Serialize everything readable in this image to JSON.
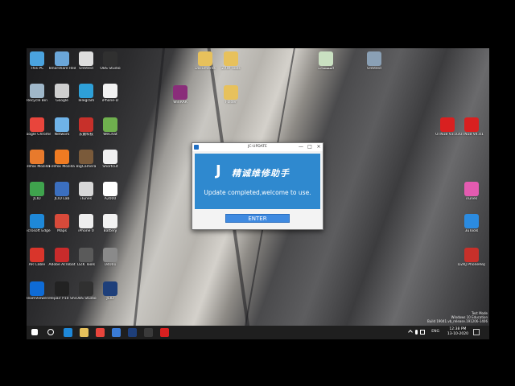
{
  "dialog": {
    "title": "JC-UPDATE",
    "brand_text": "精诚维修助手",
    "logo_glyph": "J",
    "message": "Update completed,welcome to use.",
    "enter_label": "ENTER",
    "minimize_glyph": "—",
    "maximize_glyph": "□",
    "close_glyph": "×"
  },
  "desktop": {
    "icons_left": [
      {
        "label": "This PC",
        "color": "#4aa3df"
      },
      {
        "label": "Recycle Bin",
        "color": "#9fb7c9"
      },
      {
        "label": "Google Chrome",
        "color": "#e8453c"
      },
      {
        "label": "Firefox Mozilla",
        "color": "#e87a2c"
      },
      {
        "label": "JCID",
        "color": "#3fa34d"
      },
      {
        "label": "Microsoft Edge",
        "color": "#1e88d8"
      },
      {
        "label": "AR Cable",
        "color": "#d9352b"
      },
      {
        "label": "TeamViewer",
        "color": "#0e6bd6"
      }
    ],
    "icons_col2": [
      {
        "label": "Tenorshare ReiBoot",
        "color": "#6aa6d9"
      },
      {
        "label": "Google",
        "color": "#cfcfcf"
      },
      {
        "label": "Network",
        "color": "#6fb3e8"
      },
      {
        "label": "Firefox Mozilla",
        "color": "#f07b22"
      },
      {
        "label": "JCID Lab",
        "color": "#3b6fbf"
      },
      {
        "label": "Maps",
        "color": "#d84a3a"
      },
      {
        "label": "Adobe Acrobat",
        "color": "#c92b2b"
      },
      {
        "label": "iRepair P10 Shortcut",
        "color": "#222222"
      }
    ],
    "icons_col3": [
      {
        "label": "Untitled",
        "color": "#dedede"
      },
      {
        "label": "Telegram",
        "color": "#2ea0d8"
      },
      {
        "label": "东震科技",
        "color": "#c7302a"
      },
      {
        "label": "BigCamera",
        "color": "#7a5a3a"
      },
      {
        "label": "iTunes",
        "color": "#d8d8d8"
      },
      {
        "label": "iPhone 0",
        "color": "#eeeeee"
      },
      {
        "label": "DZK Tools",
        "color": "#5a5a5a"
      },
      {
        "label": "OBS Studio",
        "color": "#303030"
      }
    ],
    "icons_col4": [
      {
        "label": "OBS Studio",
        "color": "#303030"
      },
      {
        "label": "iPhone-D",
        "color": "#f2f2f2"
      },
      {
        "label": "WeChat",
        "color": "#6fb04e"
      },
      {
        "label": "Shortcut",
        "color": "#f0f0f0"
      },
      {
        "label": "A2000",
        "color": "#ffffff"
      },
      {
        "label": "Battery",
        "color": "#f2f2f2"
      },
      {
        "label": "U4001",
        "color": "#8a8a8a"
      },
      {
        "label": "JCID",
        "color": "#1e3f7a"
      }
    ],
    "icons_top": [
      {
        "label": "Documents",
        "color": "#e7c15c"
      },
      {
        "label": "ZXW Tools",
        "color": "#e7c15c"
      },
      {
        "label": "المستندات",
        "color": "#c9e0c1"
      },
      {
        "label": "Untitled",
        "color": "#8aa0b5"
      }
    ],
    "icons_mid": [
      {
        "label": "WinRAR",
        "color": "#8a2d7a"
      },
      {
        "label": "Folder",
        "color": "#e7c15c"
      }
    ],
    "icons_right": [
      {
        "label": "UTN18 V3.03",
        "color": "#d92020"
      },
      {
        "label": "UTN18 V4.01",
        "color": "#d92020"
      },
      {
        "label": "iTunes",
        "color": "#e45bb0"
      },
      {
        "label": "3uTools",
        "color": "#2b8be0"
      },
      {
        "label": "DZKJ PhoneRepair",
        "color": "#c7302a"
      }
    ]
  },
  "taskbar": {
    "apps": [
      {
        "name": "start",
        "color": "#ffffff"
      },
      {
        "name": "search",
        "color": "#ffffff"
      },
      {
        "name": "edge",
        "color": "#1e88d8"
      },
      {
        "name": "explorer",
        "color": "#e7c15c"
      },
      {
        "name": "chrome",
        "color": "#e8453c"
      },
      {
        "name": "store",
        "color": "#3a7bd5"
      },
      {
        "name": "jcid",
        "color": "#1e3f7a"
      },
      {
        "name": "obs",
        "color": "#3a3a3a"
      },
      {
        "name": "app-red",
        "color": "#d92020"
      }
    ],
    "language": "ENG",
    "time": "12:38 PM",
    "date": "13-10-2020"
  },
  "watermark": {
    "line1": "Test Mode",
    "line2": "Windows 10 Education",
    "line3": "Build 19041.vb_release.191206-1406"
  }
}
